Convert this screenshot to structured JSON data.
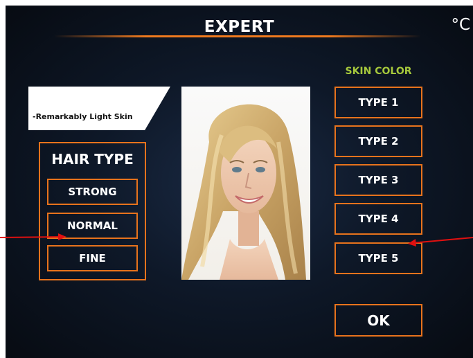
{
  "header": {
    "title": "EXPERT",
    "unit": "°C"
  },
  "info": {
    "text": "-Remarkably Light Skin"
  },
  "hair_type": {
    "title": "HAIR TYPE",
    "options": [
      "STRONG",
      "NORMAL",
      "FINE"
    ]
  },
  "skin_color": {
    "title": "SKIN COLOR",
    "options": [
      "TYPE 1",
      "TYPE 2",
      "TYPE 3",
      "TYPE 4",
      "TYPE 5"
    ]
  },
  "ok": {
    "label": "OK"
  },
  "colors": {
    "accent": "#e8731c",
    "skin_label": "#a6c83c",
    "annotation": "#e01010"
  }
}
